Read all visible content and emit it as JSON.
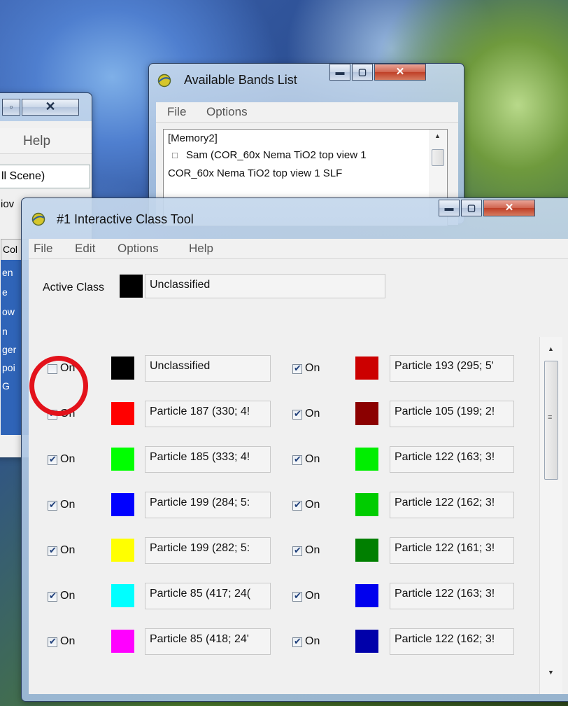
{
  "left_window": {
    "menu": "Help",
    "rows": [
      "ll Scene)",
      "iov",
      "Col",
      "en",
      "e",
      "ow",
      "n",
      "ger",
      "poi",
      "G"
    ]
  },
  "bands_window": {
    "title": "Available Bands List",
    "menu": [
      "File",
      "Options"
    ],
    "list": [
      "[Memory2]",
      "Sam (COR_60x Nema TiO2 top view 1",
      "COR_60x Nema TiO2 top view 1 SLF"
    ]
  },
  "class_window": {
    "title": "#1 Interactive Class Tool",
    "menu": [
      "File",
      "Edit",
      "Options",
      "Help"
    ],
    "active_class_label": "Active Class",
    "active_class_value": "Unclassified",
    "checkbox_label": "On",
    "colors": {
      "c0": "#000000",
      "c1": "#ff0000",
      "c2": "#00ff00",
      "c3": "#0000ff",
      "c4": "#ffff00",
      "c5": "#00ffff",
      "c6": "#ff00ff",
      "d0": "#cc0000",
      "d1": "#8b0000",
      "d2": "#00ee00",
      "d3": "#00cc00",
      "d4": "#007f00",
      "d5": "#0000ee",
      "d6": "#0000aa"
    },
    "classes_left": [
      {
        "name": "Unclassified",
        "on": false
      },
      {
        "name": "Particle 187 (330; 4!",
        "on": true
      },
      {
        "name": "Particle 185 (333; 4!",
        "on": true
      },
      {
        "name": "Particle 199 (284; 5:",
        "on": true
      },
      {
        "name": "Particle 199 (282; 5:",
        "on": true
      },
      {
        "name": "Particle 85 (417; 24(",
        "on": true
      },
      {
        "name": "Particle 85 (418; 24'",
        "on": true
      }
    ],
    "classes_right": [
      {
        "name": "Particle 193 (295; 5'",
        "on": true
      },
      {
        "name": "Particle 105 (199; 2!",
        "on": true
      },
      {
        "name": "Particle 122 (163; 3!",
        "on": true
      },
      {
        "name": "Particle 122 (162; 3!",
        "on": true
      },
      {
        "name": "Particle 122 (161; 3!",
        "on": true
      },
      {
        "name": "Particle 122 (163; 3!",
        "on": true
      },
      {
        "name": "Particle 122 (162; 3!",
        "on": true
      }
    ]
  }
}
